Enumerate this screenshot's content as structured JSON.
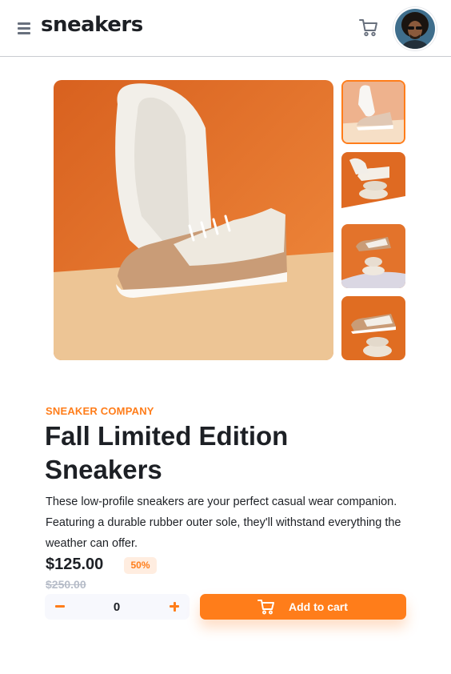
{
  "header": {
    "logo": "sneakers",
    "icons": {
      "menu": "menu-icon",
      "cart": "cart-icon",
      "avatar": "user-avatar"
    }
  },
  "gallery": {
    "selected_index": 0,
    "thumbnails": [
      "sneaker-thumbnail-1",
      "sneaker-thumbnail-2",
      "sneaker-thumbnail-3",
      "sneaker-thumbnail-4"
    ]
  },
  "product": {
    "company": "SNEAKER COMPANY",
    "title": "Fall Limited Edition Sneakers",
    "description": "These low-profile sneakers are your perfect casual wear companion. Featuring a durable rubber outer sole, they'll withstand everything the weather can offer.",
    "price": "$125.00",
    "discount": "50%",
    "original_price": "$250.00"
  },
  "cart_controls": {
    "quantity": "0",
    "add_label": "Add to cart"
  },
  "colors": {
    "accent": "#ff7d1a",
    "accent_pale": "#ffede0",
    "text_dark": "#1d2025",
    "text_muted": "#b6bcc8"
  }
}
